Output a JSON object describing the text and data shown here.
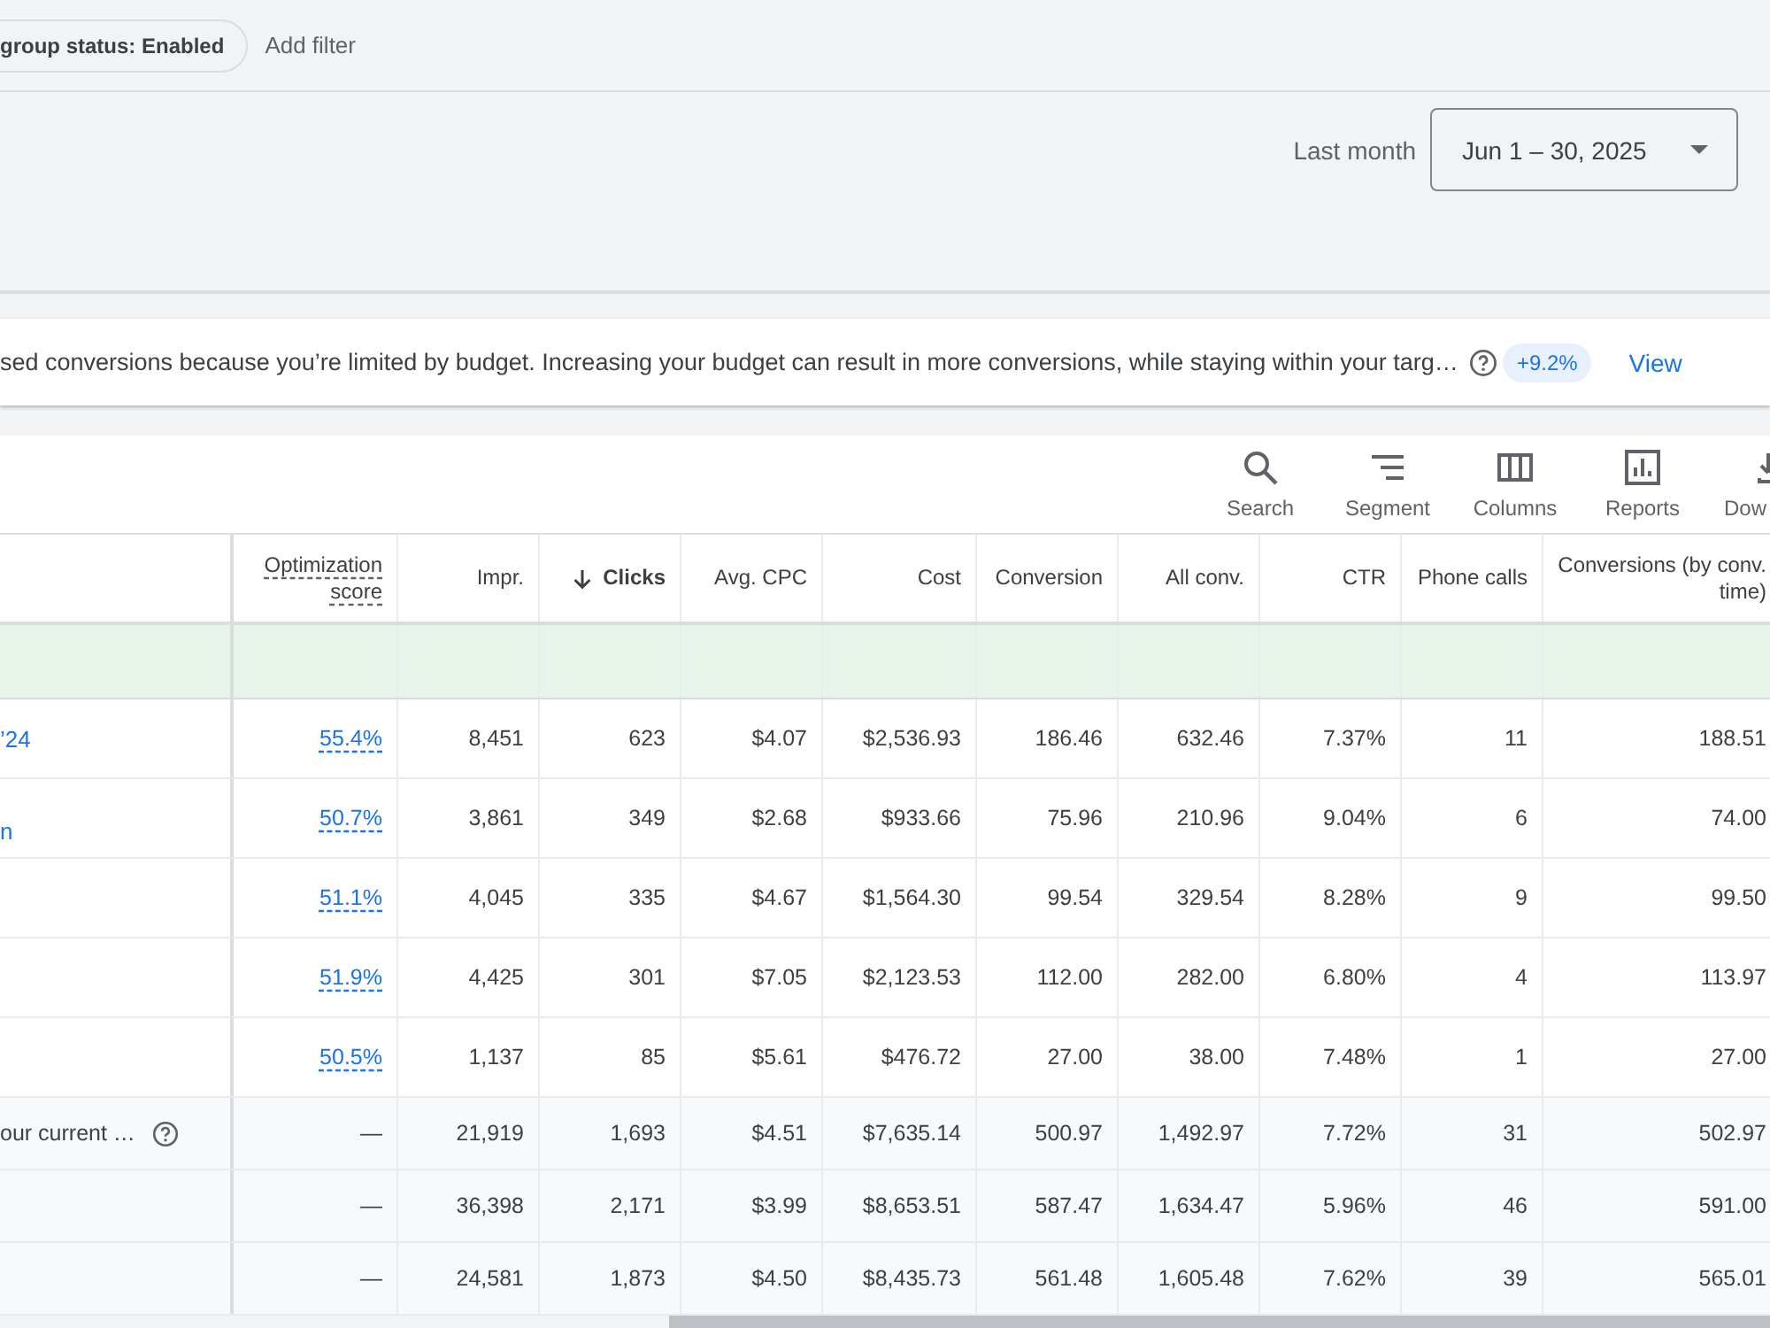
{
  "filter_bar": {
    "chips": [
      {
        "label": "group status: Enabled"
      }
    ],
    "add_filter": "Add filter"
  },
  "date_range": {
    "preset": "Last month",
    "value": "Jun 1 – 30, 2025"
  },
  "recommendation": {
    "text": "sed conversions because you’re limited by budget. Increasing your budget can result in more conversions, while staying within your targ…",
    "uplift": "+9.2%",
    "action": "View"
  },
  "toolbar": [
    {
      "kind": "search",
      "label": "Search"
    },
    {
      "kind": "segment",
      "label": "Segment"
    },
    {
      "kind": "columns",
      "label": "Columns"
    },
    {
      "kind": "reports",
      "label": "Reports"
    },
    {
      "kind": "download",
      "label": "Dow"
    }
  ],
  "table": {
    "columns": [
      {
        "label": "Optimization score",
        "hint": true,
        "sorted": false
      },
      {
        "label": "Impr.",
        "hint": false,
        "sorted": false
      },
      {
        "label": "Clicks",
        "hint": false,
        "sorted": true
      },
      {
        "label": "Avg. CPC",
        "hint": false,
        "sorted": false
      },
      {
        "label": "Cost",
        "hint": false,
        "sorted": false
      },
      {
        "label": "Conversion",
        "hint": false,
        "sorted": false
      },
      {
        "label": "All conv.",
        "hint": false,
        "sorted": false
      },
      {
        "label": "CTR",
        "hint": false,
        "sorted": false
      },
      {
        "label": "Phone calls",
        "hint": false,
        "sorted": false
      },
      {
        "label": "Conversions (by conv. time)",
        "hint": false,
        "sorted": false
      }
    ],
    "rows": [
      {
        "name": "’24",
        "wrapped": false,
        "cells": [
          "55.4%",
          "8,451",
          "623",
          "$4.07",
          "$2,536.93",
          "186.46",
          "632.46",
          "7.37%",
          "11",
          "188.51"
        ]
      },
      {
        "name": "n",
        "wrapped": true,
        "cells": [
          "50.7%",
          "3,861",
          "349",
          "$2.68",
          "$933.66",
          "75.96",
          "210.96",
          "9.04%",
          "6",
          "74.00"
        ]
      },
      {
        "cells": [
          "51.1%",
          "4,045",
          "335",
          "$4.67",
          "$1,564.30",
          "99.54",
          "329.54",
          "8.28%",
          "9",
          "99.50"
        ]
      },
      {
        "cells": [
          "51.9%",
          "4,425",
          "301",
          "$7.05",
          "$2,123.53",
          "112.00",
          "282.00",
          "6.80%",
          "4",
          "113.97"
        ]
      },
      {
        "cells": [
          "50.5%",
          "1,137",
          "85",
          "$5.61",
          "$476.72",
          "27.00",
          "38.00",
          "7.48%",
          "1",
          "27.00"
        ]
      }
    ],
    "totals": [
      {
        "label": "our current …",
        "help": true,
        "cells": [
          "—",
          "21,919",
          "1,693",
          "$4.51",
          "$7,635.14",
          "500.97",
          "1,492.97",
          "7.72%",
          "31",
          "502.97"
        ]
      },
      {
        "help": false,
        "cells": [
          "—",
          "36,398",
          "2,171",
          "$3.99",
          "$8,653.51",
          "587.47",
          "1,634.47",
          "5.96%",
          "46",
          "591.00"
        ]
      },
      {
        "help": false,
        "cells": [
          "—",
          "24,581",
          "1,873",
          "$4.50",
          "$8,435.73",
          "561.48",
          "1,605.48",
          "7.62%",
          "39",
          "565.01"
        ]
      }
    ]
  }
}
